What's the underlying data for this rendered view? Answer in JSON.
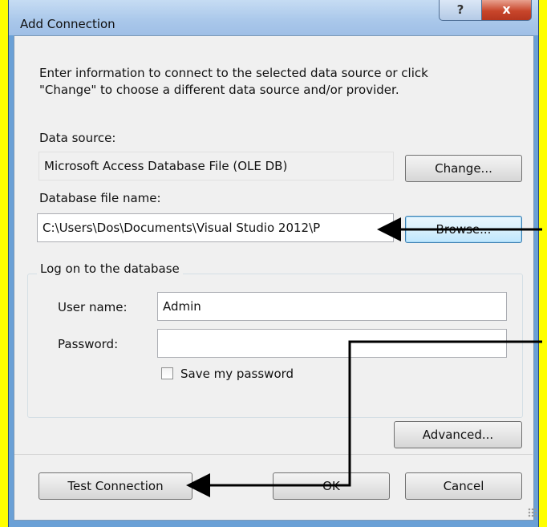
{
  "window": {
    "title": "Add Connection",
    "help_glyph": "?",
    "close_glyph": "x"
  },
  "intro_text": {
    "line1": "Enter information to connect to the selected data source or click",
    "line2": "\"Change\" to choose a different data source and/or provider."
  },
  "data_source": {
    "label": "Data source:",
    "value": "Microsoft Access Database File (OLE DB)",
    "change_button": "Change..."
  },
  "database_file": {
    "label": "Database file name:",
    "value": "C:\\Users\\Dos\\Documents\\Visual Studio 2012\\P",
    "browse_button": "Browse..."
  },
  "logon": {
    "group_label": "Log on to the database",
    "user_label": "User name:",
    "user_value": "Admin",
    "password_label": "Password:",
    "password_value": "",
    "save_password_label": "Save my password",
    "save_password_checked": false
  },
  "buttons": {
    "advanced": "Advanced...",
    "test_connection": "Test Connection",
    "ok": "OK",
    "cancel": "Cancel"
  },
  "colors": {
    "background_highlight": "#ffff00",
    "annotation_arrows": "#000000",
    "dialog_body": "#f0f0f0"
  }
}
